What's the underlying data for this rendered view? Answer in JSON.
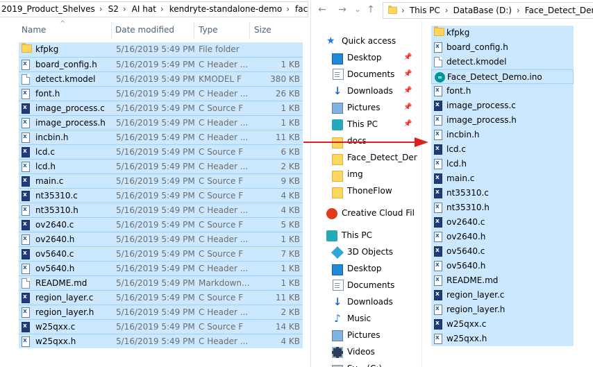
{
  "left": {
    "breadcrumbs": [
      "2019_Product_Shelves",
      "S2",
      "AI hat",
      "kendryte-standalone-demo",
      "face_detect"
    ],
    "columns": {
      "name": "Name",
      "date": "Date modified",
      "type": "Type",
      "size": "Size"
    },
    "rows": [
      {
        "icon": "folder-icon",
        "name": "kfpkg",
        "date": "5/16/2019 5:49 PM",
        "type": "File folder",
        "size": ""
      },
      {
        "icon": "c-header-file-icon",
        "name": "board_config.h",
        "date": "5/16/2019 5:49 PM",
        "type": "C Header ...",
        "size": "1 KB"
      },
      {
        "icon": "generic-file-icon",
        "name": "detect.kmodel",
        "date": "5/16/2019 5:49 PM",
        "type": "KMODEL F",
        "size": "380 KB"
      },
      {
        "icon": "c-header-file-icon",
        "name": "font.h",
        "date": "5/16/2019 5:49 PM",
        "type": "C Header ...",
        "size": "26 KB"
      },
      {
        "icon": "c-source-file-icon",
        "name": "image_process.c",
        "date": "5/16/2019 5:49 PM",
        "type": "C Source F",
        "size": "1 KB"
      },
      {
        "icon": "c-header-file-icon",
        "name": "image_process.h",
        "date": "5/16/2019 5:49 PM",
        "type": "C Header ...",
        "size": "1 KB"
      },
      {
        "icon": "c-header-file-icon",
        "name": "incbin.h",
        "date": "5/16/2019 5:49 PM",
        "type": "C Header ...",
        "size": "11 KB"
      },
      {
        "icon": "c-source-file-icon",
        "name": "lcd.c",
        "date": "5/16/2019 5:49 PM",
        "type": "C Source F",
        "size": "6 KB"
      },
      {
        "icon": "c-header-file-icon",
        "name": "lcd.h",
        "date": "5/16/2019 5:49 PM",
        "type": "C Header ...",
        "size": "2 KB"
      },
      {
        "icon": "c-source-file-icon",
        "name": "main.c",
        "date": "5/16/2019 5:49 PM",
        "type": "C Source F",
        "size": "9 KB"
      },
      {
        "icon": "c-source-file-icon",
        "name": "nt35310.c",
        "date": "5/16/2019 5:49 PM",
        "type": "C Source F",
        "size": "4 KB"
      },
      {
        "icon": "c-header-file-icon",
        "name": "nt35310.h",
        "date": "5/16/2019 5:49 PM",
        "type": "C Header ...",
        "size": "4 KB"
      },
      {
        "icon": "c-source-file-icon",
        "name": "ov2640.c",
        "date": "5/16/2019 5:49 PM",
        "type": "C Source F",
        "size": "5 KB"
      },
      {
        "icon": "c-header-file-icon",
        "name": "ov2640.h",
        "date": "5/16/2019 5:49 PM",
        "type": "C Header ...",
        "size": "1 KB"
      },
      {
        "icon": "c-source-file-icon",
        "name": "ov5640.c",
        "date": "5/16/2019 5:49 PM",
        "type": "C Source F",
        "size": "7 KB"
      },
      {
        "icon": "c-header-file-icon",
        "name": "ov5640.h",
        "date": "5/16/2019 5:49 PM",
        "type": "C Header ...",
        "size": "1 KB"
      },
      {
        "icon": "generic-file-icon",
        "name": "README.md",
        "date": "5/16/2019 5:49 PM",
        "type": "Markdown...",
        "size": "1 KB"
      },
      {
        "icon": "c-source-file-icon",
        "name": "region_layer.c",
        "date": "5/16/2019 5:49 PM",
        "type": "C Source F",
        "size": "11 KB"
      },
      {
        "icon": "c-header-file-icon",
        "name": "region_layer.h",
        "date": "5/16/2019 5:49 PM",
        "type": "C Header ...",
        "size": "2 KB"
      },
      {
        "icon": "c-source-file-icon",
        "name": "w25qxx.c",
        "date": "5/16/2019 5:49 PM",
        "type": "C Source F",
        "size": "14 KB"
      },
      {
        "icon": "c-header-file-icon",
        "name": "w25qxx.h",
        "date": "5/16/2019 5:49 PM",
        "type": "C Header ...",
        "size": "4 KB"
      }
    ]
  },
  "right": {
    "nav_buttons": {
      "back": "←",
      "forward": "→",
      "recent": "⌄",
      "up": "↑"
    },
    "breadcrumbs": [
      "This PC",
      "DataBase (D:)",
      "Face_Detect_Demo"
    ],
    "nav_items": [
      {
        "label": "Quick access",
        "icon": "star-icon",
        "pinned": false,
        "indent": 0
      },
      {
        "label": "Desktop",
        "icon": "desktop-icon",
        "pinned": true,
        "indent": 1
      },
      {
        "label": "Documents",
        "icon": "documents-icon",
        "pinned": true,
        "indent": 1
      },
      {
        "label": "Downloads",
        "icon": "downloads-icon",
        "pinned": true,
        "indent": 1
      },
      {
        "label": "Pictures",
        "icon": "pictures-icon",
        "pinned": true,
        "indent": 1
      },
      {
        "label": "This PC",
        "icon": "this-pc-icon",
        "pinned": true,
        "indent": 1
      },
      {
        "label": "docs",
        "icon": "folder-icon",
        "pinned": false,
        "indent": 1
      },
      {
        "label": "Face_Detect_Der",
        "icon": "folder-icon",
        "pinned": false,
        "indent": 1
      },
      {
        "label": "img",
        "icon": "folder-icon",
        "pinned": false,
        "indent": 1
      },
      {
        "label": "ThoneFlow",
        "icon": "folder-icon",
        "pinned": false,
        "indent": 1
      },
      {
        "label": "Creative Cloud Fil",
        "icon": "creative-cloud-icon",
        "pinned": false,
        "indent": 0
      },
      {
        "label": "This PC",
        "icon": "this-pc-icon",
        "pinned": false,
        "indent": 0
      },
      {
        "label": "3D Objects",
        "icon": "3d-objects-icon",
        "pinned": false,
        "indent": 1
      },
      {
        "label": "Desktop",
        "icon": "desktop-icon",
        "pinned": false,
        "indent": 1
      },
      {
        "label": "Documents",
        "icon": "documents-icon",
        "pinned": false,
        "indent": 1
      },
      {
        "label": "Downloads",
        "icon": "downloads-icon",
        "pinned": false,
        "indent": 1
      },
      {
        "label": "Music",
        "icon": "music-icon",
        "pinned": false,
        "indent": 1
      },
      {
        "label": "Pictures",
        "icon": "pictures-icon",
        "pinned": false,
        "indent": 1
      },
      {
        "label": "Videos",
        "icon": "videos-icon",
        "pinned": false,
        "indent": 1
      },
      {
        "label": "Sy... (C:)",
        "icon": "drive-icon",
        "pinned": false,
        "indent": 1
      }
    ],
    "files": [
      {
        "icon": "folder-icon",
        "name": "kfpkg"
      },
      {
        "icon": "c-header-file-icon",
        "name": "board_config.h"
      },
      {
        "icon": "generic-file-icon",
        "name": "detect.kmodel"
      },
      {
        "icon": "arduino-file-icon",
        "name": "Face_Detect_Demo.ino",
        "focused": true
      },
      {
        "icon": "c-header-file-icon",
        "name": "font.h"
      },
      {
        "icon": "c-source-file-icon",
        "name": "image_process.c"
      },
      {
        "icon": "c-header-file-icon",
        "name": "image_process.h"
      },
      {
        "icon": "c-header-file-icon",
        "name": "incbin.h"
      },
      {
        "icon": "c-source-file-icon",
        "name": "lcd.c"
      },
      {
        "icon": "c-header-file-icon",
        "name": "lcd.h"
      },
      {
        "icon": "c-source-file-icon",
        "name": "main.c"
      },
      {
        "icon": "c-source-file-icon",
        "name": "nt35310.c"
      },
      {
        "icon": "c-header-file-icon",
        "name": "nt35310.h"
      },
      {
        "icon": "c-source-file-icon",
        "name": "ov2640.c"
      },
      {
        "icon": "c-header-file-icon",
        "name": "ov2640.h"
      },
      {
        "icon": "c-source-file-icon",
        "name": "ov5640.c"
      },
      {
        "icon": "c-header-file-icon",
        "name": "ov5640.h"
      },
      {
        "icon": "c-header-file-icon",
        "name": "README.md"
      },
      {
        "icon": "c-source-file-icon",
        "name": "region_layer.c"
      },
      {
        "icon": "c-header-file-icon",
        "name": "region_layer.h"
      },
      {
        "icon": "c-source-file-icon",
        "name": "w25qxx.c"
      },
      {
        "icon": "c-header-file-icon",
        "name": "w25qxx.h"
      }
    ]
  },
  "colors": {
    "selection": "#cce8ff",
    "selection_border": "#99d1ff",
    "arrow": "#e0201c",
    "header_text": "#4c607a"
  }
}
